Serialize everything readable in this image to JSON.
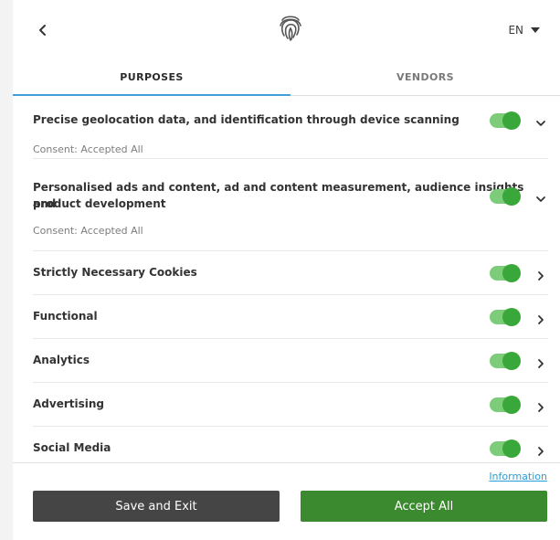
{
  "header": {
    "back_icon": "chevron-left-icon",
    "logo_icon": "fingerprint-icon",
    "language": "EN",
    "language_icon": "caret-down-icon"
  },
  "tabs": [
    {
      "label": "PURPOSES",
      "active": true
    },
    {
      "label": "VENDORS",
      "active": false
    }
  ],
  "purposes": [
    {
      "title": "Precise geolocation data, and identification through device scanning",
      "consent": "Consent: Accepted All",
      "enabled": true,
      "expand_icon": "chevron-down-icon"
    },
    {
      "title_line1": "Personalised ads and content, ad and content measurement, audience insights and",
      "title_line2": "product development",
      "consent": "Consent: Accepted All",
      "enabled": true,
      "expand_icon": "chevron-down-icon"
    },
    {
      "title": "Strictly Necessary Cookies",
      "enabled": true,
      "expand_icon": "chevron-right-icon"
    },
    {
      "title": "Functional",
      "enabled": true,
      "expand_icon": "chevron-right-icon"
    },
    {
      "title": "Analytics",
      "enabled": true,
      "expand_icon": "chevron-right-icon"
    },
    {
      "title": "Advertising",
      "enabled": true,
      "expand_icon": "chevron-right-icon"
    },
    {
      "title": "Social Media",
      "enabled": true,
      "expand_icon": "chevron-right-icon"
    }
  ],
  "footer": {
    "info_link": "Information",
    "save_label": "Save and Exit",
    "accept_label": "Accept All"
  },
  "colors": {
    "accent_blue": "#3ea0d6",
    "toggle_on": "#3aa73a",
    "accept_green": "#3b8a2f",
    "save_dark": "#454545"
  }
}
